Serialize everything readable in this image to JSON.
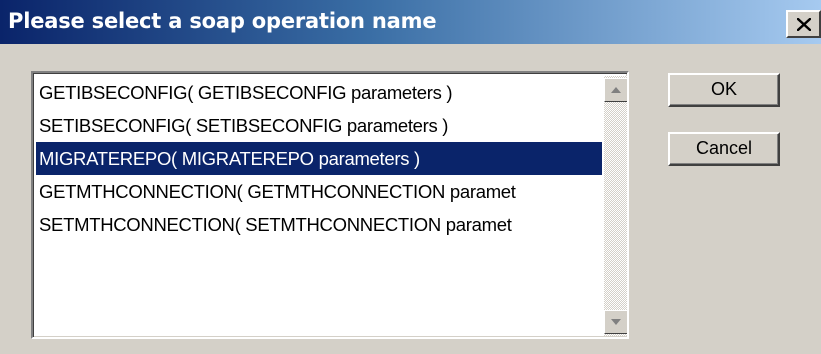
{
  "window": {
    "title": "Please select a soap operation name",
    "close_icon": "close-icon"
  },
  "list": {
    "items": [
      {
        "label": "GETIBSECONFIG( GETIBSECONFIG parameters )",
        "selected": false
      },
      {
        "label": "SETIBSECONFIG( SETIBSECONFIG parameters )",
        "selected": false
      },
      {
        "label": "MIGRATEREPO( MIGRATEREPO parameters )",
        "selected": true
      },
      {
        "label": "GETMTHCONNECTION( GETMTHCONNECTION paramet",
        "selected": false
      },
      {
        "label": "SETMTHCONNECTION( SETMTHCONNECTION paramet",
        "selected": false
      }
    ]
  },
  "buttons": {
    "ok_label": "OK",
    "cancel_label": "Cancel"
  },
  "colors": {
    "selection": "#0a246a",
    "titlebar_start": "#0a246a",
    "titlebar_end": "#a6caf0",
    "face": "#d4d0c8"
  }
}
